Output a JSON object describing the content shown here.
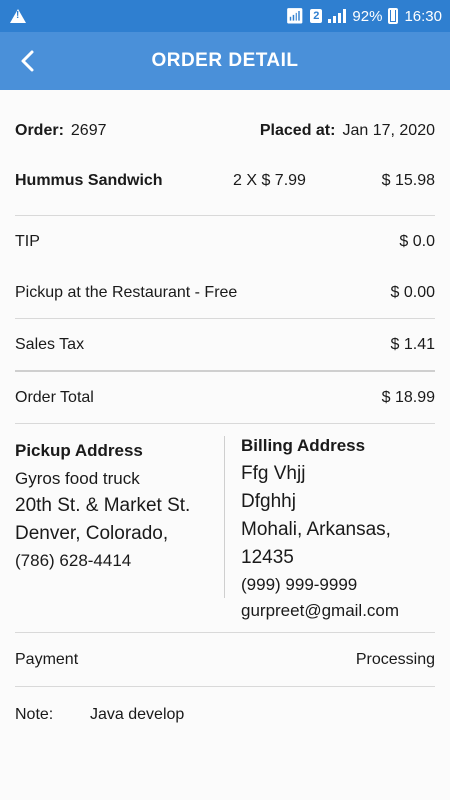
{
  "status_bar": {
    "sim_slot": "2",
    "battery": "92%",
    "time": "16:30"
  },
  "header": {
    "title": "ORDER DETAIL"
  },
  "order": {
    "order_label": "Order:",
    "order_number": "2697",
    "placed_label": "Placed at:",
    "placed_date": "Jan 17, 2020"
  },
  "items": [
    {
      "name": "Hummus Sandwich",
      "qty": "2 X $ 7.99",
      "amount": "$ 15.98"
    }
  ],
  "charges": {
    "tip_label": "TIP",
    "tip_amount": "$ 0.0",
    "pickup_label": "Pickup at the Restaurant - Free",
    "pickup_amount": "$ 0.00",
    "tax_label": "Sales Tax",
    "tax_amount": "$ 1.41",
    "total_label": "Order Total",
    "total_amount": "$ 18.99"
  },
  "pickup_address": {
    "title": "Pickup Address",
    "name": "Gyros food truck",
    "street": "20th St. & Market St.",
    "city": "Denver, Colorado,",
    "phone": "(786) 628-4414"
  },
  "billing_address": {
    "title": "Billing Address",
    "name": "Ffg Vhjj",
    "street": "Dfghhj",
    "city": "Mohali, Arkansas,",
    "zip": "12435",
    "phone": "(999) 999-9999",
    "email": "gurpreet@gmail.com"
  },
  "payment": {
    "label": "Payment",
    "status": "Processing"
  },
  "note": {
    "label": "Note:",
    "text": "Java develop"
  },
  "colors": {
    "status_bar": "#2f7fd0",
    "header": "#4a90d9"
  }
}
